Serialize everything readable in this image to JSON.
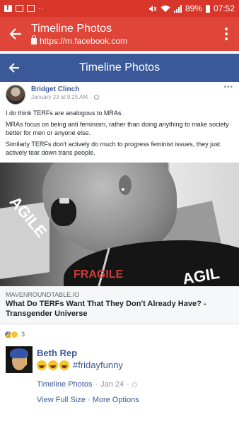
{
  "status_bar": {
    "battery": "89%",
    "time": "07:52",
    "notification_icons": [
      "facebook-icon",
      "image-icon",
      "mail-icon"
    ],
    "more": "··"
  },
  "custom_tab": {
    "title": "Timeline Photos",
    "url": "https://m.facebook.com"
  },
  "fb_header": {
    "title": "Timeline Photos"
  },
  "post": {
    "author": "Bridget Clinch",
    "date": "January 23 at 9:25 AM",
    "sep": "·",
    "more": "•••",
    "paragraphs": [
      "I do think TERFs are analogous to MRAs.",
      "MRAs focus on being anti feminism, rather than doing anything to make society better for men or anyone else.",
      "Similarly TERFs don't actively do much to progress feminist issues, they just actively tear down trans people."
    ],
    "image_texts": [
      "AGILE",
      "AGIL",
      "FRAGILE"
    ],
    "link": {
      "domain": "MAVENROUNDTABLE.IO",
      "title": "What Do TERFs Want That They Don't Already Have? - Transgender Universe"
    },
    "reactions": {
      "count": "3",
      "types": [
        "like-icon",
        "haha-icon"
      ]
    }
  },
  "comment": {
    "name": "Beth Rep",
    "text": "#fridayfunny",
    "emojis": [
      "laughing-emoji",
      "laughing-emoji",
      "laughing-emoji"
    ],
    "source": "Timeline Photos",
    "sep": "·",
    "date": "Jan 24",
    "view_full_size": "View Full Size",
    "more_options": "More Options"
  },
  "colors": {
    "status_bar": "#d8362b",
    "chrome_bar": "#e0453a",
    "fb_blue": "#3b5998",
    "link_blue": "#3b5998"
  }
}
